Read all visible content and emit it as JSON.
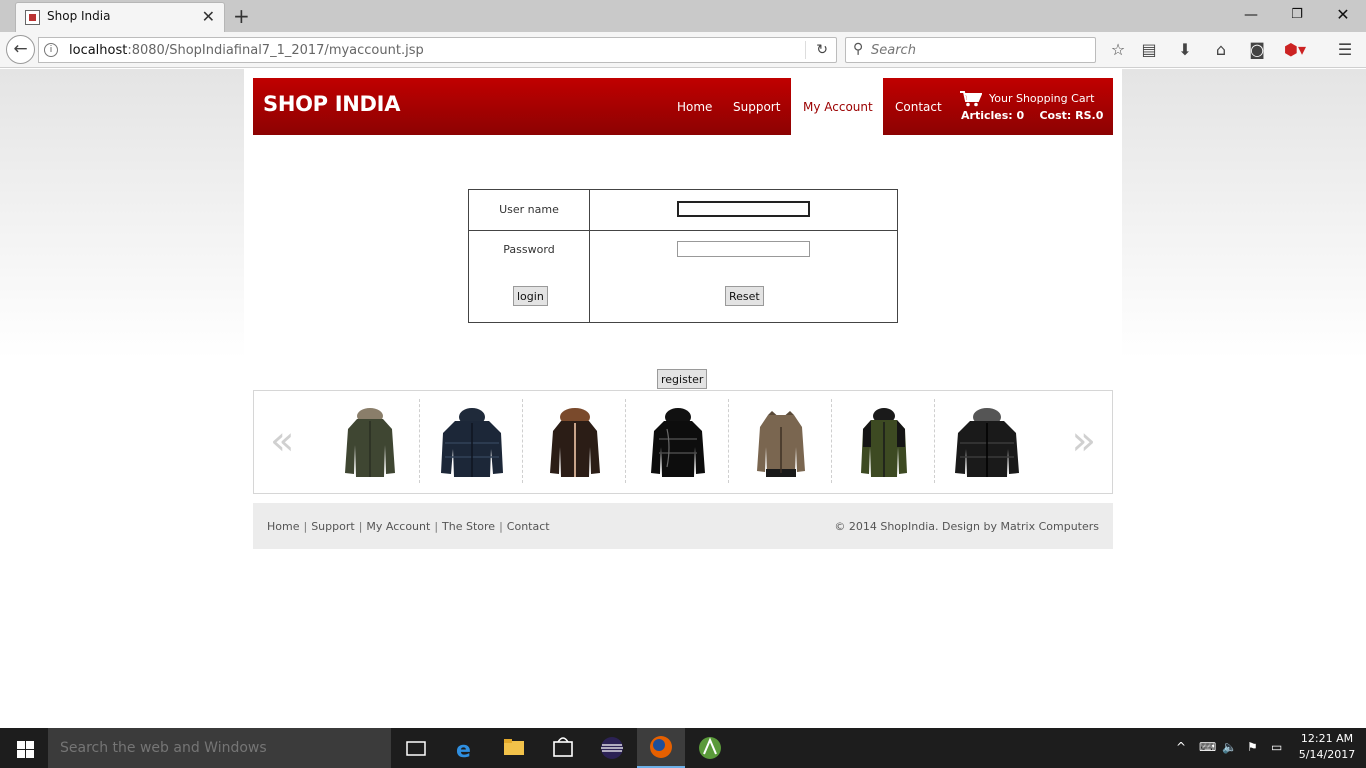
{
  "browser": {
    "tab_title": "Shop India",
    "url_host": "localhost",
    "url_rest": ":8080/ShopIndiafinal7_1_2017/myaccount.jsp",
    "search_placeholder": "Search"
  },
  "site": {
    "logo": "SHOP INDIA",
    "nav": {
      "home": "Home",
      "support": "Support",
      "my_account": "My Account",
      "contact": "Contact"
    },
    "cart": {
      "title": "Your Shopping Cart",
      "info": "Articles: 0    Cost: RS.0"
    },
    "login": {
      "username_label": "User name",
      "password_label": "Password",
      "login_button": "login",
      "reset_button": "Reset",
      "username_value": "",
      "password_value": ""
    },
    "register_button": "register",
    "carousel": {
      "prev": "«",
      "next": "»",
      "items": [
        "olive-fur-parka",
        "navy-puffer",
        "brown-fur-jacket",
        "black-shiny-puffer",
        "brown-bomber",
        "green-black-parka",
        "black-hooded-puffer"
      ]
    },
    "footer": {
      "links": [
        "Home",
        "Support",
        "My Account",
        "The Store",
        "Contact"
      ],
      "copyright": "© 2014 ShopIndia. Design by Matrix Computers"
    }
  },
  "taskbar": {
    "search_placeholder": "Search the web and Windows",
    "time": "12:21 AM",
    "date": "5/14/2017"
  },
  "colors": {
    "brand_red": "#c00000",
    "active_nav_text": "#9b0000"
  }
}
